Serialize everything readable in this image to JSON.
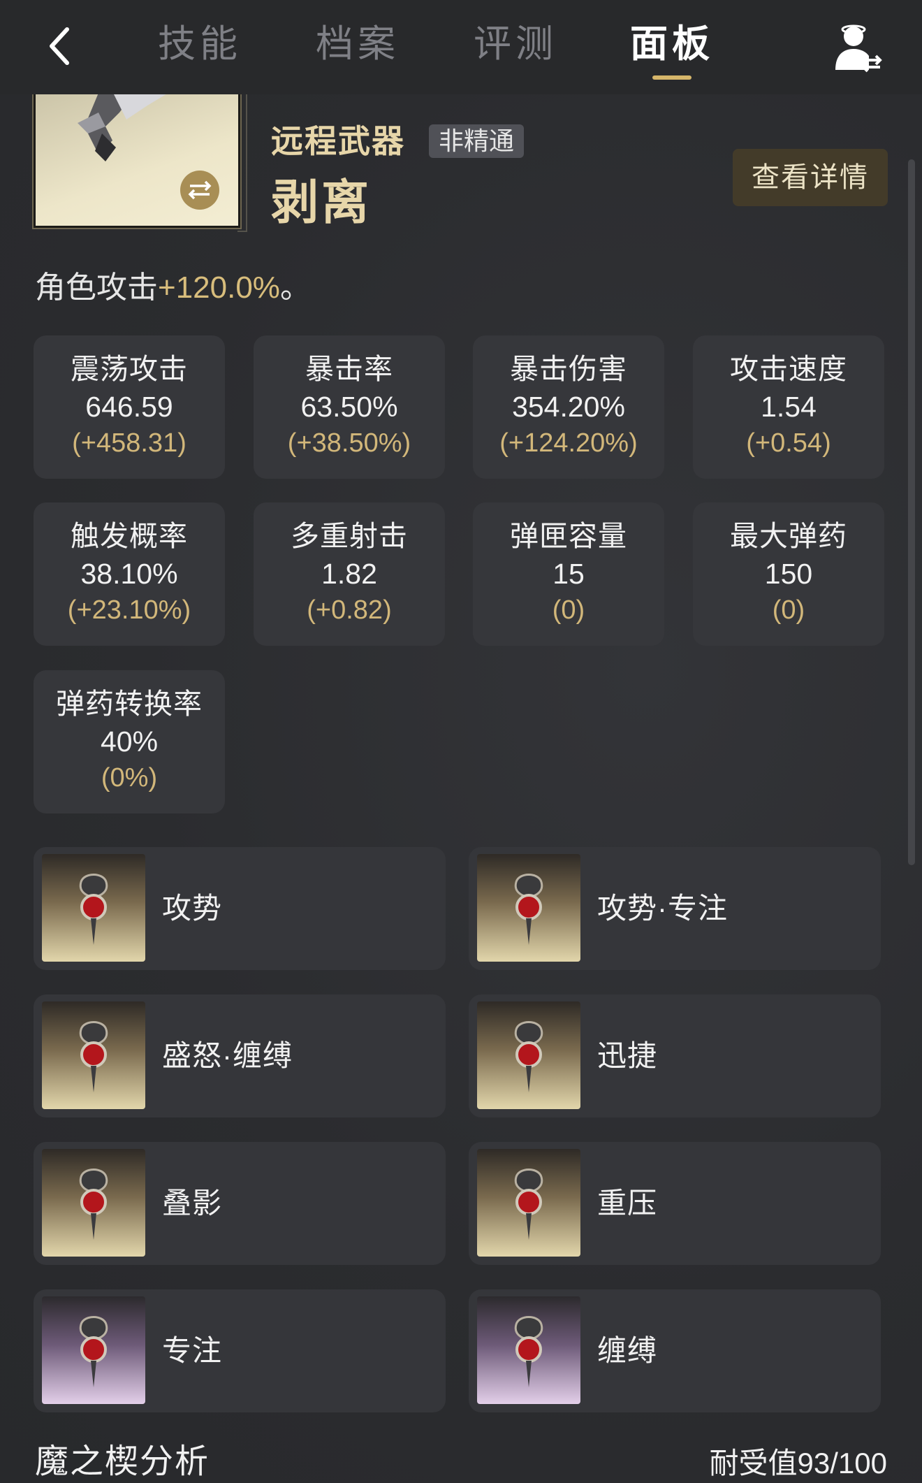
{
  "nav": {
    "tabs": [
      {
        "label": "技能",
        "active": false
      },
      {
        "label": "档案",
        "active": false
      },
      {
        "label": "评测",
        "active": false
      },
      {
        "label": "面板",
        "active": true
      }
    ],
    "back_icon": "chevron-left-icon",
    "switch_icon": "user-switch-icon",
    "accent_color": "#d6b66a"
  },
  "weapon": {
    "type": "远程武器",
    "mastery": "非精通",
    "name": "剥离",
    "detail_button": "查看详情",
    "swap_icon": "swap-arrows-icon"
  },
  "bonus": {
    "prefix": "角色攻击",
    "value": "+120.0%",
    "suffix": "。"
  },
  "stats": [
    {
      "label": "震荡攻击",
      "value": "646.59",
      "delta": "(+458.31)"
    },
    {
      "label": "暴击率",
      "value": "63.50%",
      "delta": "(+38.50%)"
    },
    {
      "label": "暴击伤害",
      "value": "354.20%",
      "delta": "(+124.20%)"
    },
    {
      "label": "攻击速度",
      "value": "1.54",
      "delta": "(+0.54)"
    },
    {
      "label": "触发概率",
      "value": "38.10%",
      "delta": "(+23.10%)"
    },
    {
      "label": "多重射击",
      "value": "1.82",
      "delta": "(+0.82)"
    },
    {
      "label": "弹匣容量",
      "value": "15",
      "delta": "(0)"
    },
    {
      "label": "最大弹药",
      "value": "150",
      "delta": "(0)"
    },
    {
      "label": "弹药转换率",
      "value": "40%",
      "delta": "(0%)"
    }
  ],
  "mods": [
    {
      "name": "攻势",
      "rarity": "gold"
    },
    {
      "name": "攻势·专注",
      "rarity": "gold"
    },
    {
      "name": "盛怒·缠缚",
      "rarity": "gold"
    },
    {
      "name": "迅捷",
      "rarity": "gold"
    },
    {
      "name": "叠影",
      "rarity": "gold"
    },
    {
      "name": "重压",
      "rarity": "gold"
    },
    {
      "name": "专注",
      "rarity": "purple"
    },
    {
      "name": "缠缚",
      "rarity": "purple"
    }
  ],
  "analysis": {
    "title": "魔之楔分析",
    "tolerance": "耐受值93/100"
  }
}
